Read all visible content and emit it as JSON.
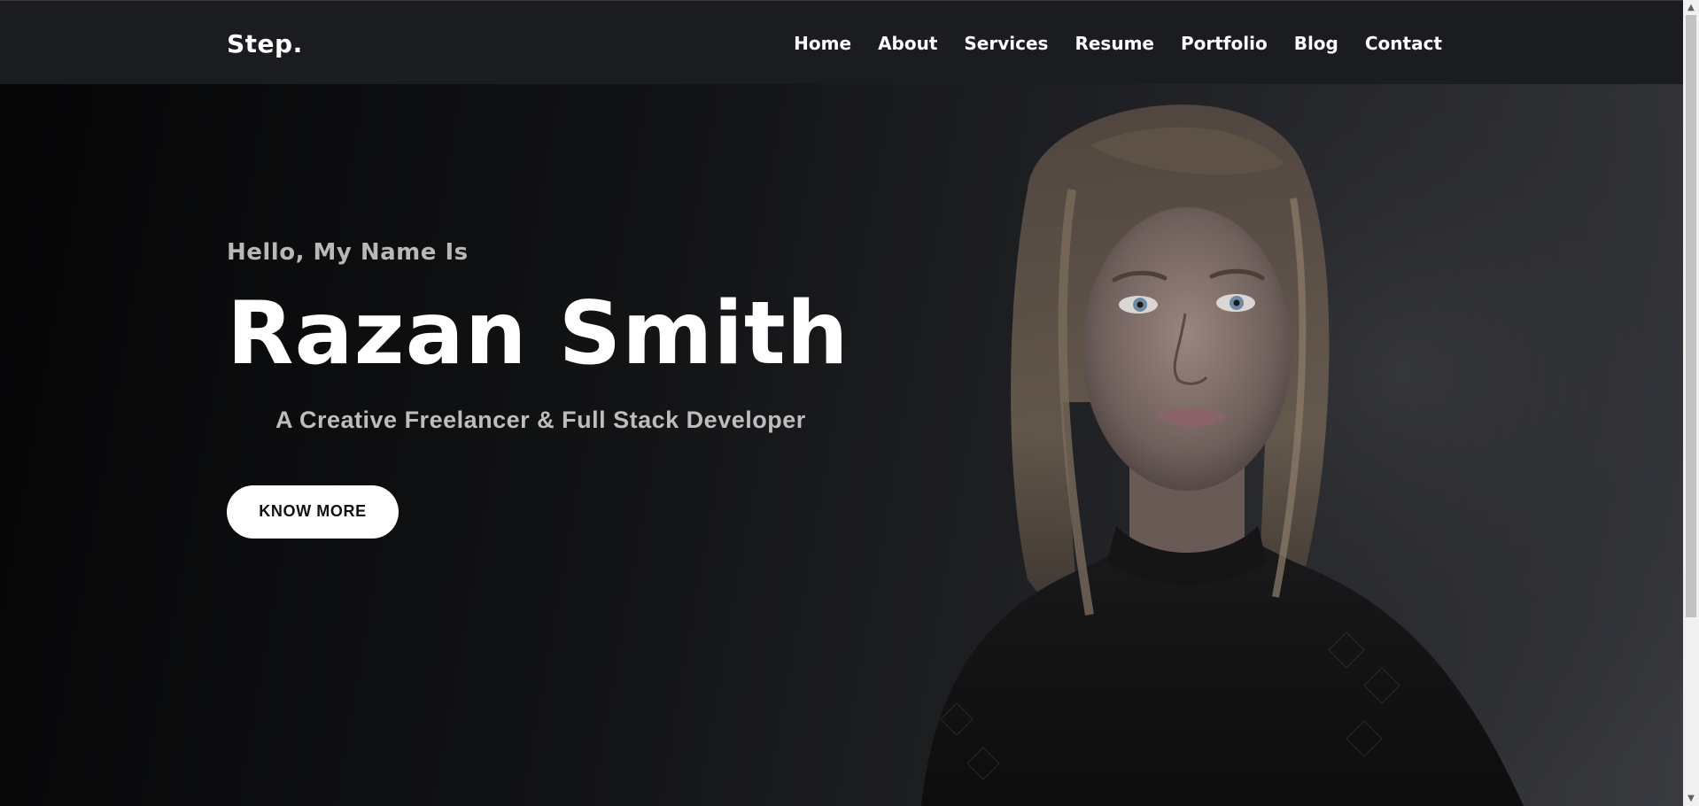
{
  "header": {
    "brand": "Step.",
    "nav": [
      {
        "label": "Home"
      },
      {
        "label": "About"
      },
      {
        "label": "Services"
      },
      {
        "label": "Resume"
      },
      {
        "label": "Portfolio"
      },
      {
        "label": "Blog"
      },
      {
        "label": "Contact"
      }
    ]
  },
  "hero": {
    "greeting": "Hello, My Name Is",
    "name": "Razan Smith",
    "tagline": "A Creative Freelancer & Full Stack Developer",
    "cta_label": "KNOW MORE"
  },
  "colors": {
    "background": "#0b0b0d",
    "header_bg": "#1b1c1f",
    "text_primary": "#ffffff",
    "text_secondary": "#b8b8b8",
    "button_bg": "#ffffff",
    "button_text": "#111111"
  },
  "icons": {
    "scroll_up": "chevron-up-icon",
    "scroll_down": "chevron-down-icon"
  }
}
